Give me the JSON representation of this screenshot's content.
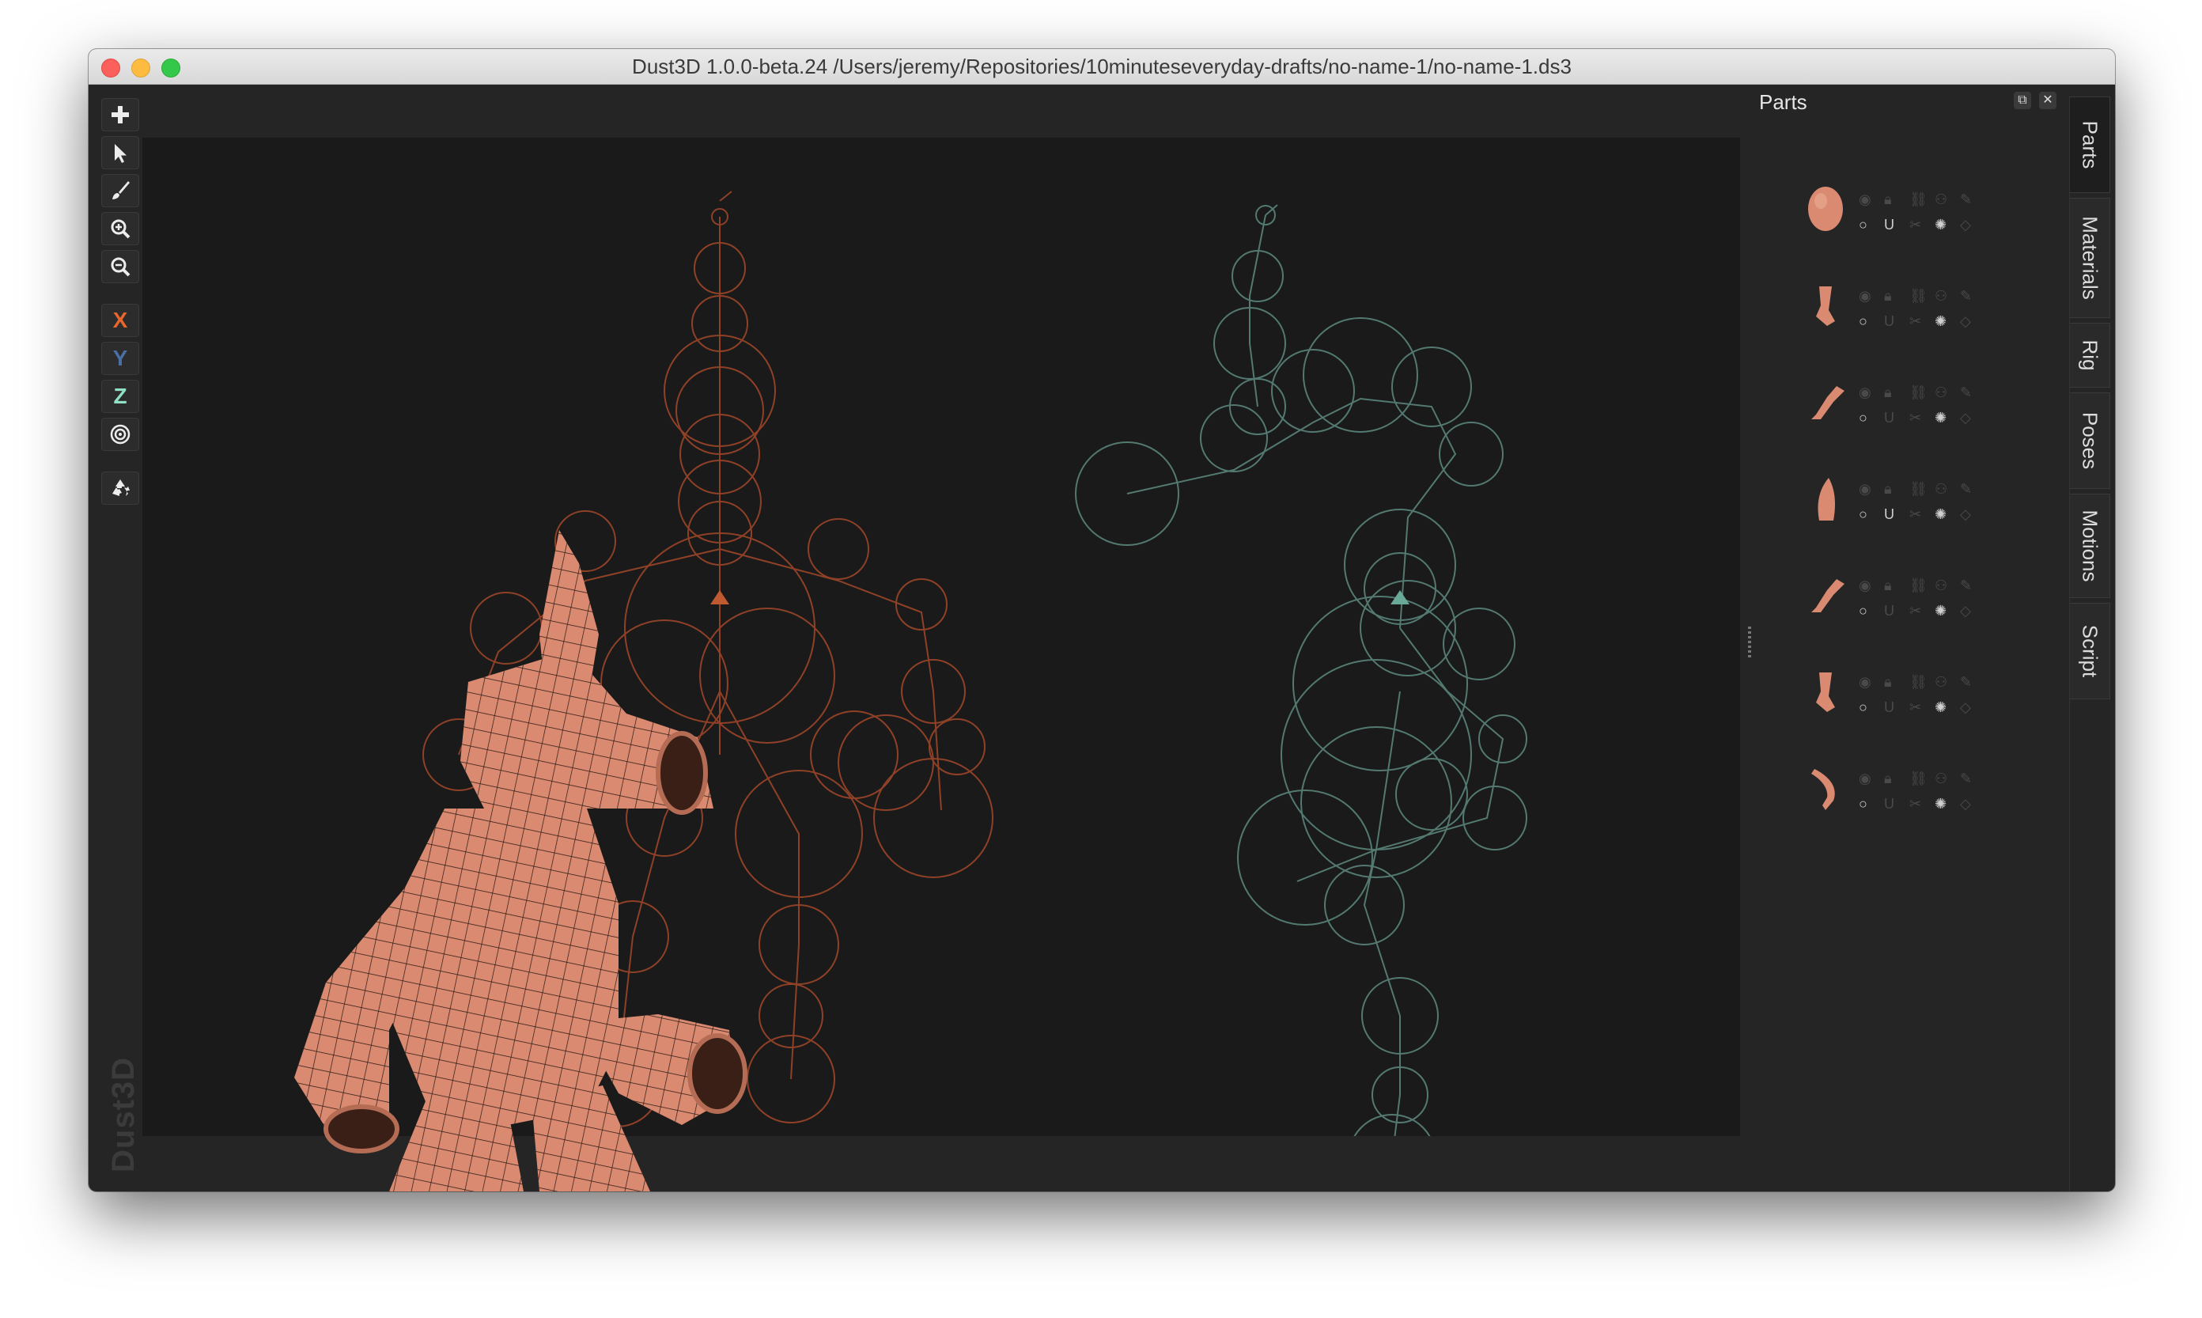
{
  "window": {
    "title": "Dust3D 1.0.0-beta.24 /Users/jeremy/Repositories/10minuteseveryday-drafts/no-name-1/no-name-1.ds3",
    "brand": "Dust3D"
  },
  "toolbar": {
    "x_label": "X",
    "y_label": "Y",
    "z_label": "Z",
    "x_color": "#e8662b",
    "y_color": "#4a6fa5",
    "z_color": "#8fe0c4",
    "icons": [
      "add-icon",
      "select-icon",
      "paint-icon",
      "zoom-in-icon",
      "zoom-out-icon",
      "radial-icon",
      "recycle-icon"
    ]
  },
  "panel": {
    "title": "Parts",
    "tabs": [
      "Parts",
      "Materials",
      "Rig",
      "Poses",
      "Motions",
      "Script"
    ],
    "active_tab": "Parts",
    "parts": [
      {
        "icon": "head-part-icon"
      },
      {
        "icon": "leg-part-icon"
      },
      {
        "icon": "arm-part-icon"
      },
      {
        "icon": "horn-part-icon"
      },
      {
        "icon": "arm-part-icon"
      },
      {
        "icon": "leg-part-icon"
      },
      {
        "icon": "tail-part-icon"
      }
    ]
  },
  "colors": {
    "skin": "#d98a70",
    "front_skeleton": "#a4482a",
    "side_skeleton": "#5d8a80",
    "viewport_bg": "#1a1a1a"
  }
}
